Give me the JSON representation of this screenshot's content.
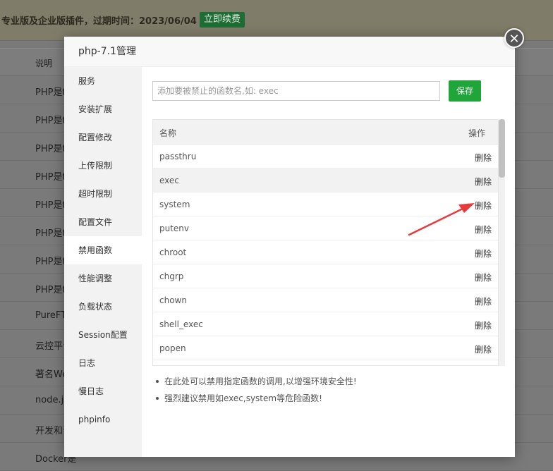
{
  "background": {
    "banner_text": "专业版及企业版插件，过期时间：2023/06/04",
    "renew_button": "立即续费",
    "column_header": "说明",
    "rows": [
      "PHP是t",
      "PHP是t",
      "PHP是t",
      "PHP是t",
      "PHP是t",
      "PHP是t",
      "PHP是t",
      "PHP是t",
      "PureFT",
      "云控平台",
      "著名We",
      "node.js",
      "开发和调",
      "Docker是"
    ]
  },
  "dialog": {
    "title": "php-7.1管理",
    "close_icon": "close-icon",
    "sidebar": {
      "items": [
        "服务",
        "安装扩展",
        "配置修改",
        "上传限制",
        "超时限制",
        "配置文件",
        "禁用函数",
        "性能调整",
        "负载状态",
        "Session配置",
        "日志",
        "慢日志",
        "phpinfo"
      ],
      "active": "禁用函数"
    },
    "input": {
      "placeholder": "添加要被禁止的函数名,如: exec",
      "value": ""
    },
    "save_button": "保存",
    "table": {
      "columns": [
        "名称",
        "操作"
      ],
      "rows": [
        {
          "name": "passthru",
          "action": "删除"
        },
        {
          "name": "exec",
          "action": "删除"
        },
        {
          "name": "system",
          "action": "删除"
        },
        {
          "name": "putenv",
          "action": "删除"
        },
        {
          "name": "chroot",
          "action": "删除"
        },
        {
          "name": "chgrp",
          "action": "删除"
        },
        {
          "name": "chown",
          "action": "删除"
        },
        {
          "name": "shell_exec",
          "action": "删除"
        },
        {
          "name": "popen",
          "action": "删除"
        }
      ]
    },
    "tips": [
      "在此处可以禁用指定函数的调用,以增强环境安全性!",
      "强烈建议禁用如exec,system等危险函数!"
    ]
  },
  "colors": {
    "accent_green": "#20a53a",
    "annotation_arrow": "#e83a3a"
  }
}
